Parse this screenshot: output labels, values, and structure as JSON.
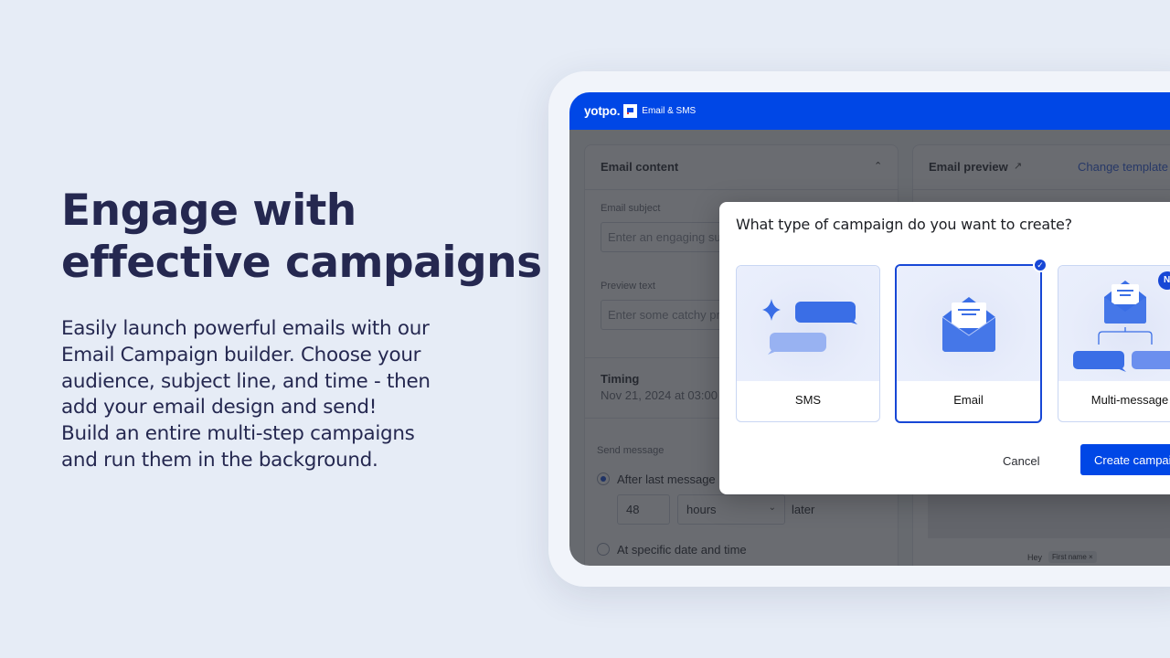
{
  "hero": {
    "title_line1": "Engage with",
    "title_line2": "effective campaigns",
    "body_lines": [
      "Easily launch powerful emails with our",
      "Email Campaign builder. Choose your",
      "audience, subject line, and time - then",
      "add your email design and send!",
      "Build an entire multi-step campaigns",
      "and run them in the background."
    ]
  },
  "app": {
    "logo": "yotpo.",
    "logo_icon": "yotpo-flag-icon",
    "name": "Email & SMS",
    "brand_color": "#0047e6"
  },
  "email_content": {
    "title": "Email content",
    "collapse_icon": "chevron-up-icon",
    "subject_label": "Email subject",
    "subject_placeholder": "Enter an engaging subject",
    "preview_label": "Preview text",
    "preview_placeholder": "Enter some catchy preview"
  },
  "timing": {
    "title": "Timing",
    "subtitle": "Nov 21, 2024 at 03:00",
    "send_label": "Send message",
    "option_after": "After last message",
    "amount": "48",
    "unit": "hours",
    "later": "later",
    "option_specific": "At specific date and time",
    "selected_option": "After last message"
  },
  "email_preview": {
    "title": "Email preview",
    "external_icon": "external-link-icon",
    "change_template": "Change template",
    "greeting": "Hey",
    "token_chip": "First name ×"
  },
  "modal": {
    "title": "What type of campaign do you want to create?",
    "options": [
      {
        "label": "SMS",
        "icon": "sms-bubbles-icon",
        "selected": false
      },
      {
        "label": "Email",
        "icon": "envelope-icon",
        "selected": true
      },
      {
        "label": "Multi-message",
        "icon": "multi-message-flow-icon",
        "selected": false,
        "badge": "N"
      }
    ],
    "cancel": "Cancel",
    "create": "Create campaign"
  }
}
